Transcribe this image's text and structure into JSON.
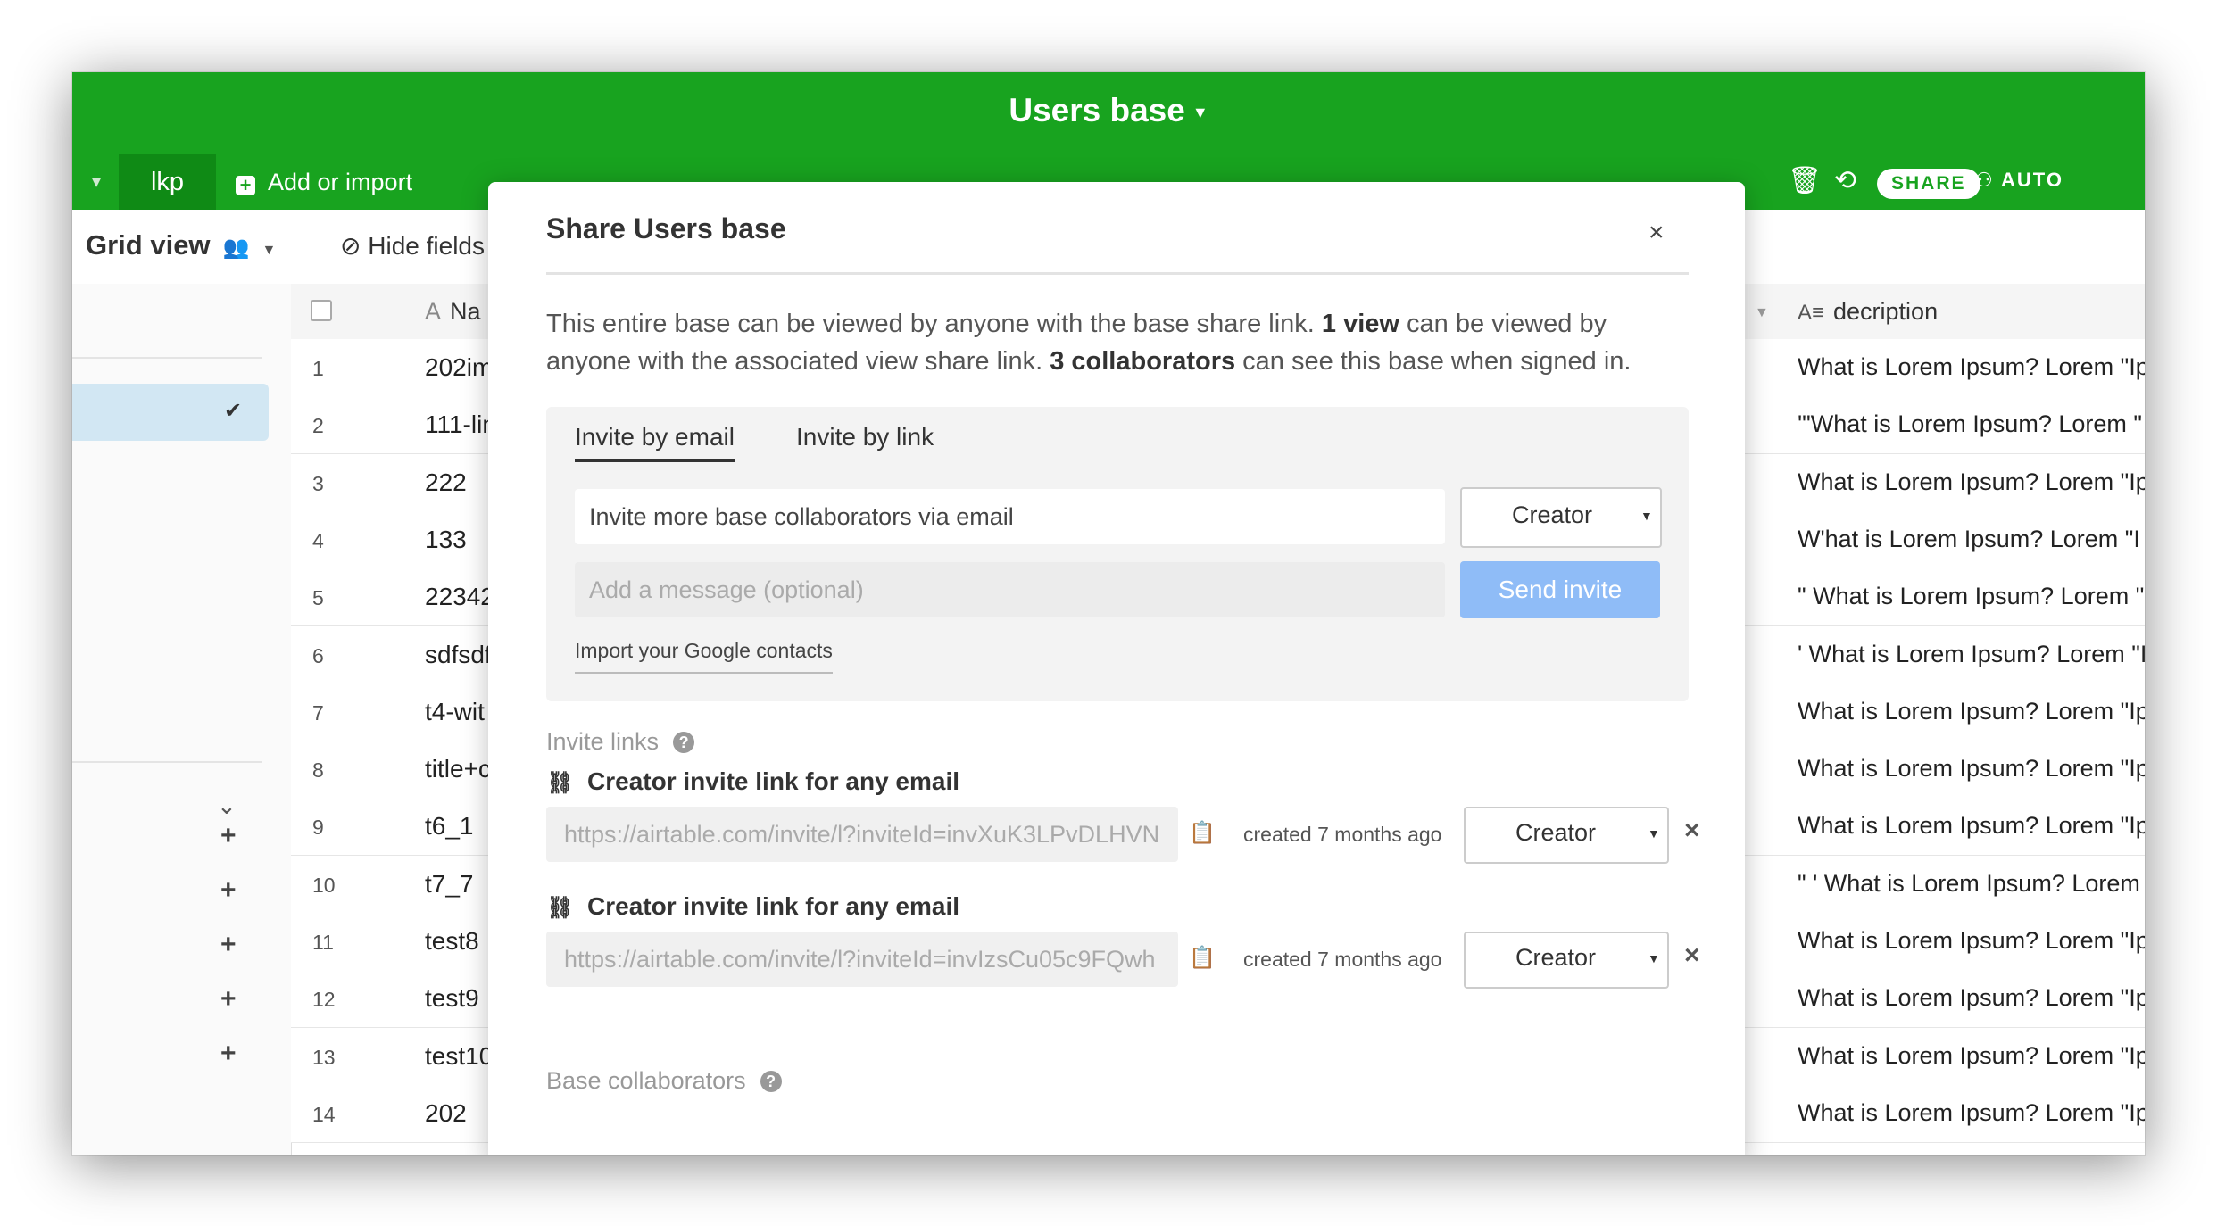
{
  "app": {
    "base_title": "Users base",
    "tabs": {
      "prev": "‹",
      "active": "lkp",
      "add_import": "Add or import"
    },
    "toolbar": {
      "share_label": "SHARE",
      "automations_label": "AUTO"
    },
    "colors": {
      "brand_green": "#18a31f",
      "send_button": "#8fbcf7"
    }
  },
  "view": {
    "name": "Grid view",
    "hide_fields": "Hide fields"
  },
  "grid": {
    "name_header": "Na",
    "description_header": "decription",
    "rows": [
      {
        "num": "1",
        "name": "202im",
        "desc": "What is Lorem Ipsum? Lorem \"Ip"
      },
      {
        "num": "2",
        "name": "111-lin",
        "desc": "'\"What is Lorem Ipsum? Lorem \""
      },
      {
        "num": "3",
        "name": "222",
        "desc": "What is Lorem Ipsum? Lorem \"Ip"
      },
      {
        "num": "4",
        "name": "133",
        "desc": "W'hat is Lorem Ipsum? Lorem \"I"
      },
      {
        "num": "5",
        "name": "22342",
        "desc": "\" What is Lorem Ipsum? Lorem \""
      },
      {
        "num": "6",
        "name": "sdfsdf",
        "desc": "' What is Lorem Ipsum? Lorem \"I"
      },
      {
        "num": "7",
        "name": "t4-wit",
        "desc": "What is Lorem Ipsum? Lorem \"Ip"
      },
      {
        "num": "8",
        "name": "title+c",
        "desc": "What is Lorem Ipsum? Lorem \"Ip"
      },
      {
        "num": "9",
        "name": "t6_1",
        "desc": "What is Lorem Ipsum? Lorem \"Ip"
      },
      {
        "num": "10",
        "name": "t7_7",
        "desc": "\" ' What is Lorem Ipsum? Lorem"
      },
      {
        "num": "11",
        "name": "test8",
        "desc": "What is Lorem Ipsum? Lorem \"Ip"
      },
      {
        "num": "12",
        "name": "test9",
        "desc": "What is Lorem Ipsum? Lorem \"Ip"
      },
      {
        "num": "13",
        "name": "test10",
        "desc": "What is Lorem Ipsum? Lorem \"Ip"
      },
      {
        "num": "14",
        "name": "202",
        "desc": "What is Lorem Ipsum? Lorem \"Ip"
      }
    ]
  },
  "modal": {
    "title": "Share Users base",
    "close": "×",
    "desc_part1": "This entire base can be viewed by anyone with the base share link. ",
    "desc_bold1": "1 view",
    "desc_part2": " can be viewed by anyone with the associated view share link. ",
    "desc_bold2": "3 collaborators",
    "desc_part3": " can see this base when signed in.",
    "tab_email": "Invite by email",
    "tab_link": "Invite by link",
    "email_placeholder": "Invite more base collaborators via email",
    "role": "Creator",
    "message_placeholder": "Add a message (optional)",
    "send_label": "Send invite",
    "google_contacts": "Import your Google contacts",
    "invite_links_label": "Invite links",
    "links": [
      {
        "title": "Creator invite link for any email",
        "url": "https://airtable.com/invite/l?inviteId=invXuK3LPvDLHVN",
        "created": "created 7 months ago",
        "role": "Creator"
      },
      {
        "title": "Creator invite link for any email",
        "url": "https://airtable.com/invite/l?inviteId=invIzsCu05c9FQwh",
        "created": "created 7 months ago",
        "role": "Creator"
      }
    ],
    "collaborators_label": "Base collaborators"
  }
}
